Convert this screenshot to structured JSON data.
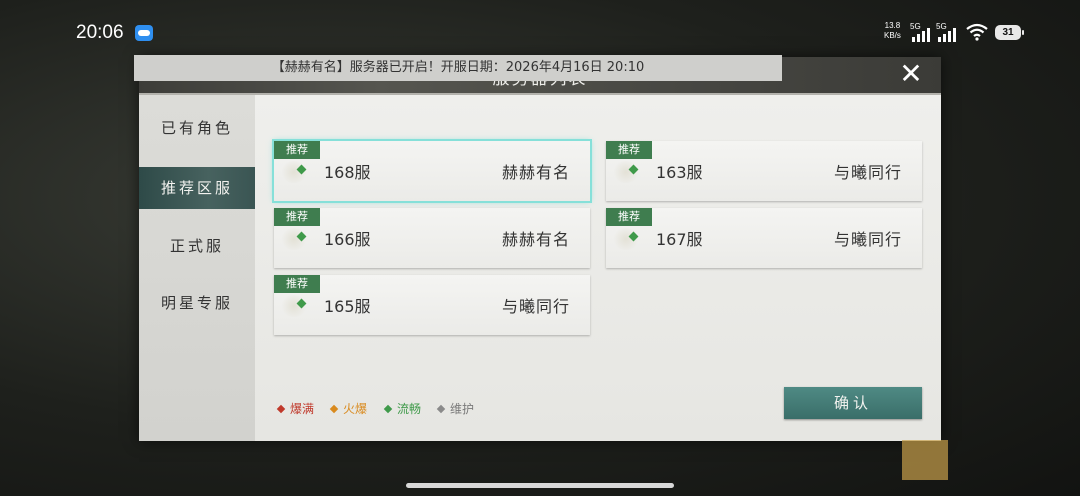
{
  "status_bar": {
    "time": "20:06",
    "net_speed_value": "13.8",
    "net_speed_unit": "KB/s",
    "sim1_type": "5G",
    "sim2_type": "5G",
    "battery": "31"
  },
  "dialog": {
    "title": "服务器列表",
    "close_label": "✕"
  },
  "sidebar": {
    "items": [
      {
        "label": "已有角色"
      },
      {
        "label": "推荐区服"
      },
      {
        "label": "正式服"
      },
      {
        "label": "明星专服"
      }
    ],
    "active_index": 1
  },
  "notice": "【赫赫有名】服务器已开启！开服日期：2026年4月16日 20:10",
  "servers": [
    {
      "badge": "推荐",
      "name": "168服",
      "owner": "赫赫有名",
      "status": "流畅",
      "selected": true
    },
    {
      "badge": "推荐",
      "name": "163服",
      "owner": "与曦同行",
      "status": "流畅",
      "selected": false
    },
    {
      "badge": "推荐",
      "name": "166服",
      "owner": "赫赫有名",
      "status": "流畅",
      "selected": false
    },
    {
      "badge": "推荐",
      "name": "167服",
      "owner": "与曦同行",
      "status": "流畅",
      "selected": false
    },
    {
      "badge": "推荐",
      "name": "165服",
      "owner": "与曦同行",
      "status": "流畅",
      "selected": false
    }
  ],
  "legend": [
    {
      "label": "爆满",
      "color": "#c0392b"
    },
    {
      "label": "火爆",
      "color": "#d98a1e"
    },
    {
      "label": "流畅",
      "color": "#3f9a4a"
    },
    {
      "label": "维护",
      "color": "#8a8a8a"
    }
  ],
  "confirm_label": "确认"
}
